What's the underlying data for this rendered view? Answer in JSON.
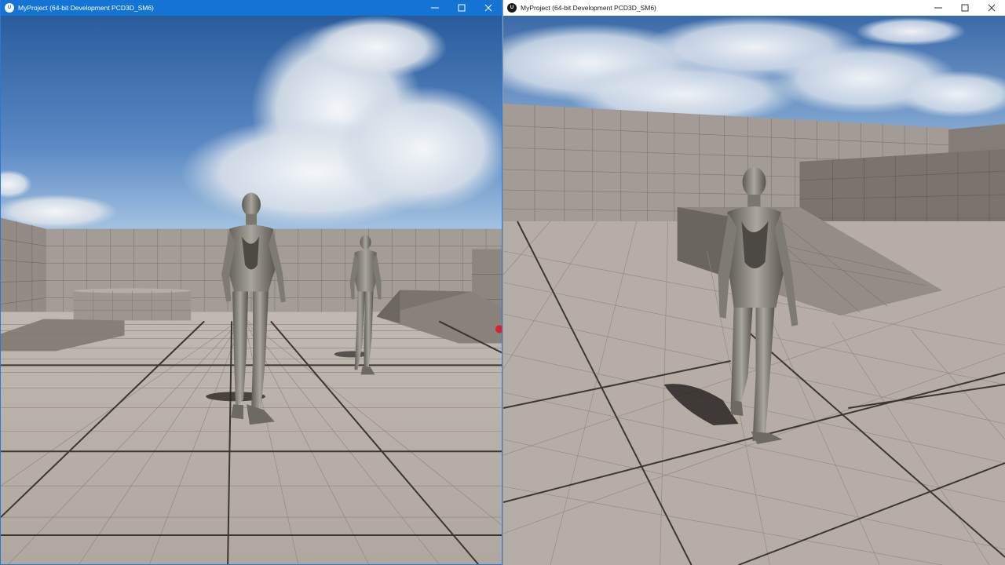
{
  "windows": [
    {
      "id": "left",
      "title": "MyProject (64-bit Development PCD3D_SM6)",
      "app_icon": "unreal-engine-icon",
      "app_icon_glyph": "U",
      "active": true,
      "titlebar_color": "#1474d4",
      "buttons": {
        "minimize": "minimize-icon",
        "maximize": "maximize-icon",
        "close": "close-icon"
      }
    },
    {
      "id": "right",
      "title": "MyProject (64-bit Development PCD3D_SM6)",
      "app_icon": "unreal-engine-icon",
      "app_icon_glyph": "U",
      "active": false,
      "titlebar_color": "#ffffff",
      "buttons": {
        "minimize": "minimize-icon",
        "maximize": "maximize-icon",
        "close": "close-icon"
      }
    }
  ],
  "colors": {
    "sky_top": "#2e5f9e",
    "sky_bottom": "#9dbfe0",
    "floor": "#b4aca4",
    "wall": "#a19a94",
    "grid_major": "#3a3530",
    "mannequin": "#8d8a82",
    "cursor_dot": "#e0202a"
  }
}
